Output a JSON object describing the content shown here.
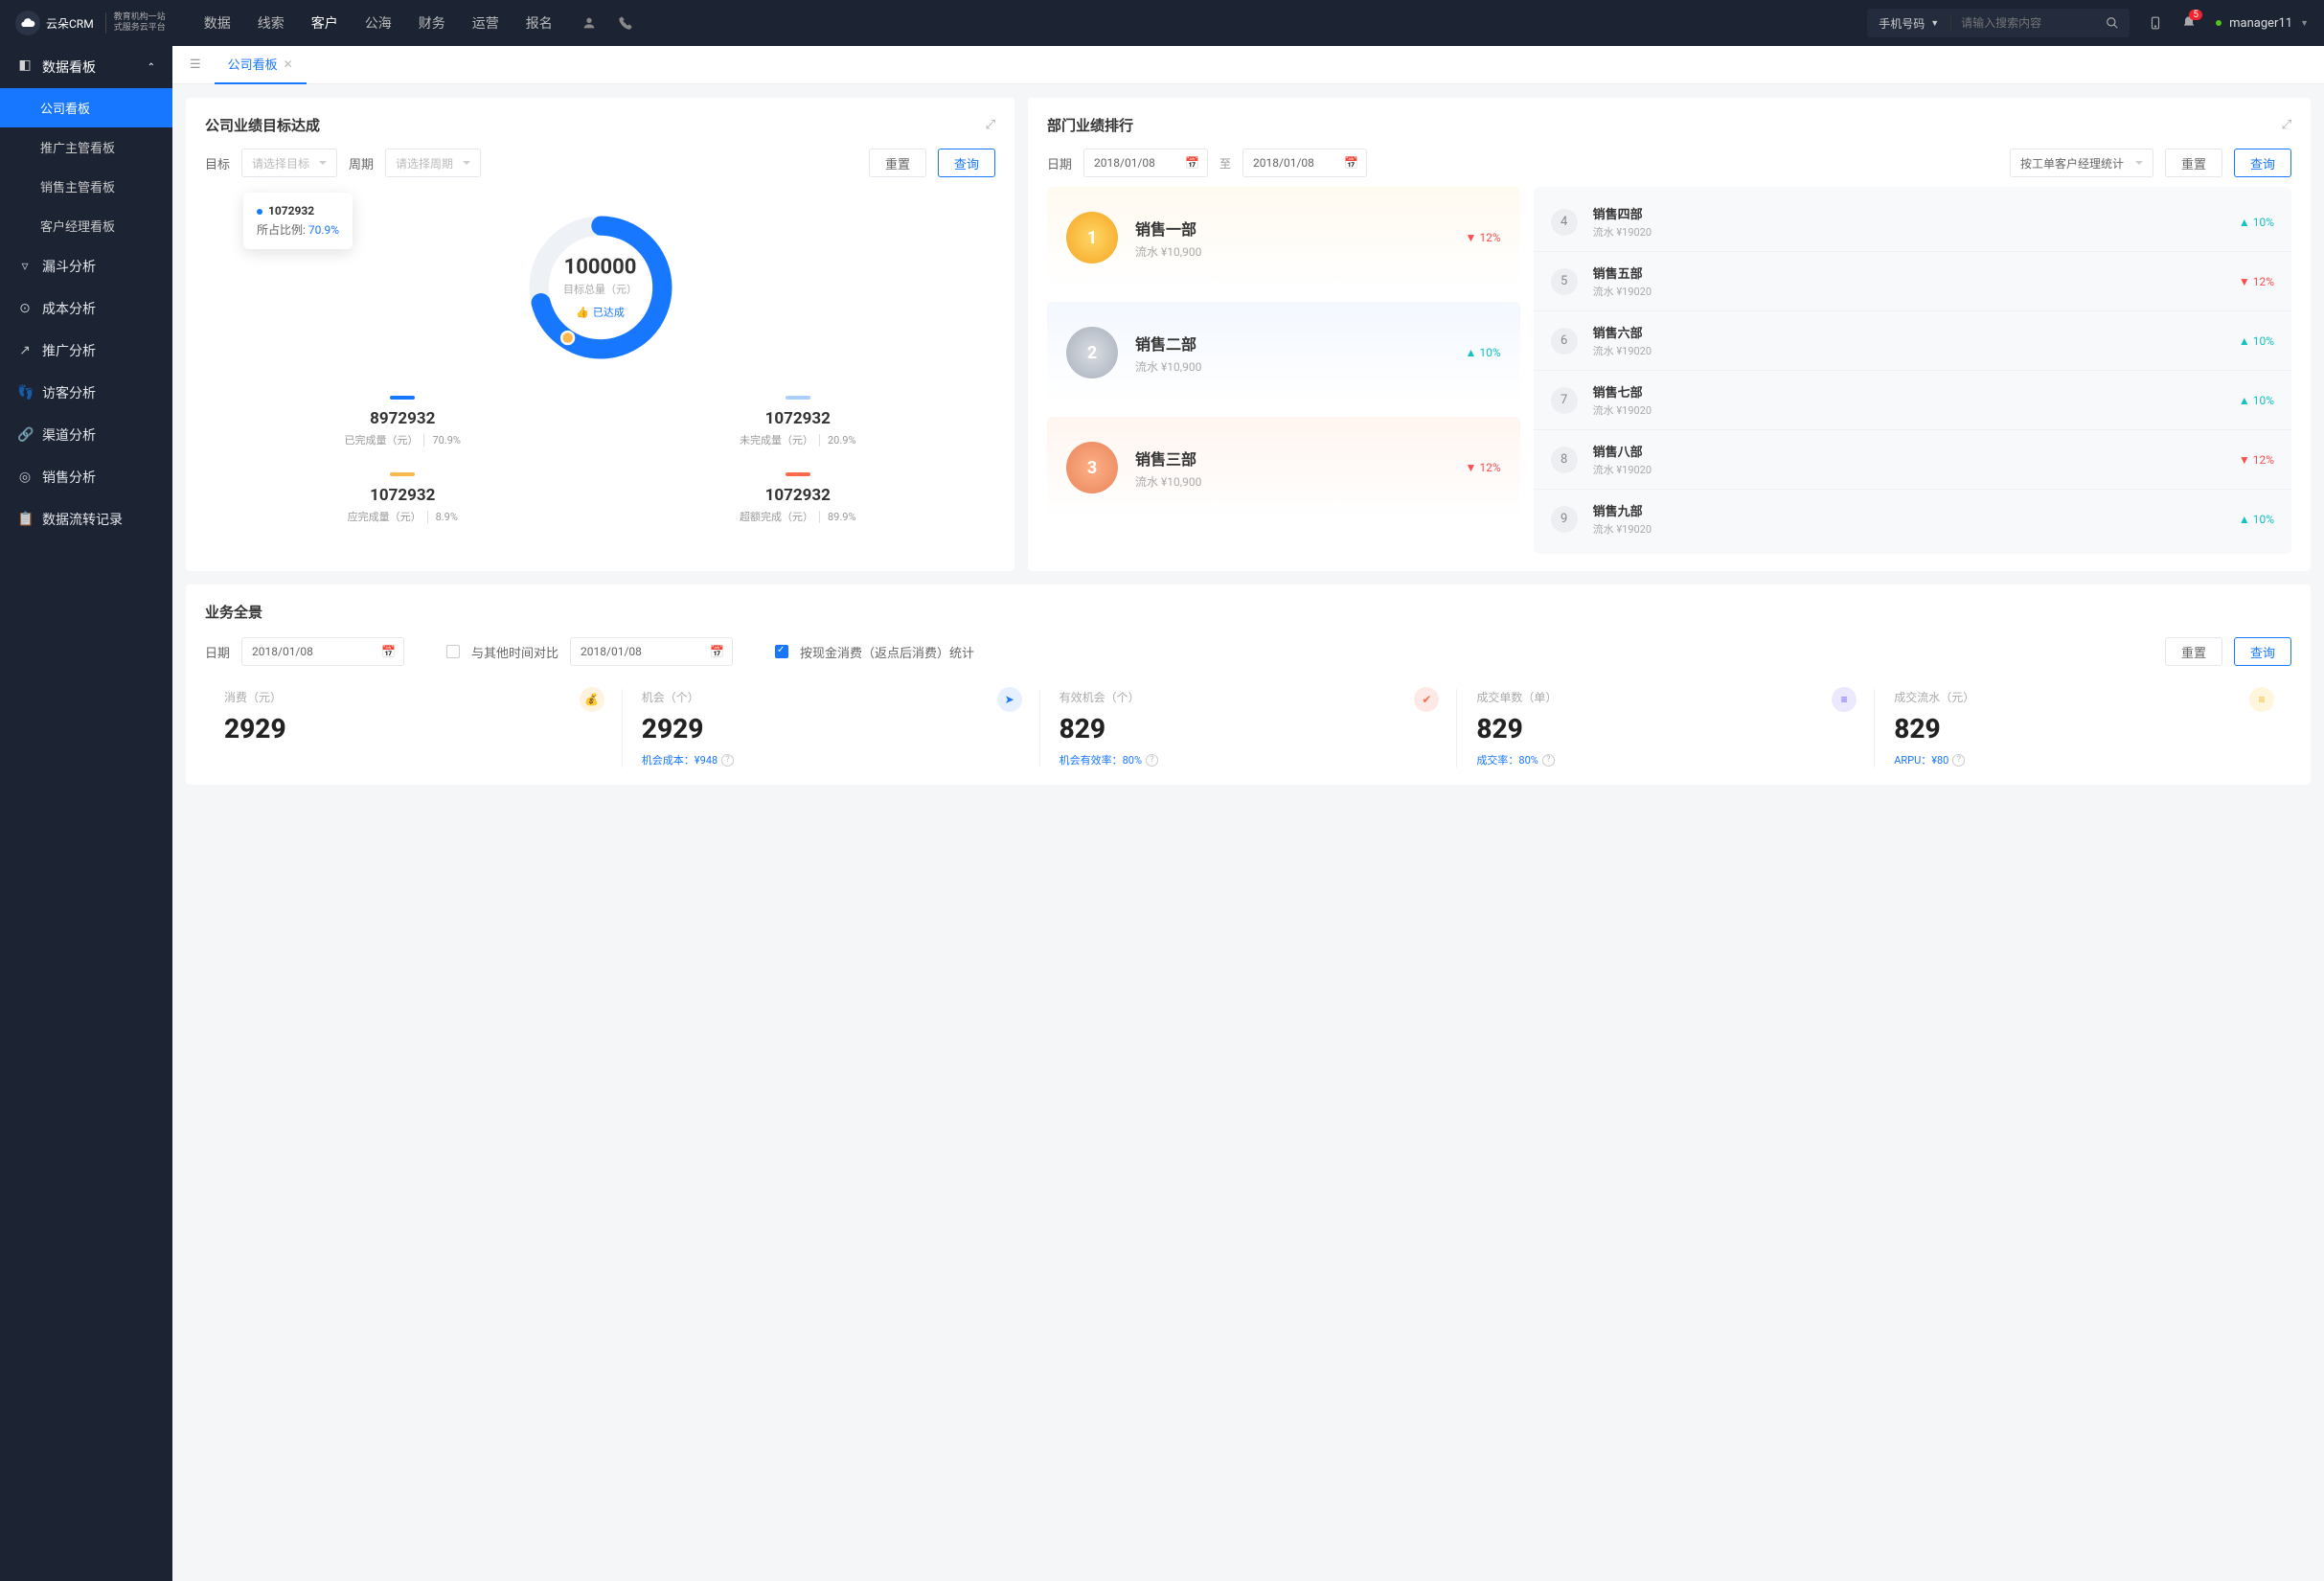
{
  "brand": {
    "name": "云朵CRM",
    "sub1": "教育机构一站",
    "sub2": "式服务云平台"
  },
  "nav": [
    "数据",
    "线索",
    "客户",
    "公海",
    "财务",
    "运营",
    "报名"
  ],
  "nav_active": 2,
  "search": {
    "type": "手机号码",
    "placeholder": "请输入搜索内容"
  },
  "notif_count": "5",
  "user": "manager11",
  "sidebar": {
    "head": "数据看板",
    "subs": [
      "公司看板",
      "推广主管看板",
      "销售主管看板",
      "客户经理看板"
    ],
    "items": [
      "漏斗分析",
      "成本分析",
      "推广分析",
      "访客分析",
      "渠道分析",
      "销售分析",
      "数据流转记录"
    ]
  },
  "tab": {
    "label": "公司看板"
  },
  "goal": {
    "title": "公司业绩目标达成",
    "lbl_target": "目标",
    "ph_target": "请选择目标",
    "lbl_period": "周期",
    "ph_period": "请选择周期",
    "btn_reset": "重置",
    "btn_query": "查询",
    "tooltip_val": "1072932",
    "tooltip_lbl": "所占比例:",
    "tooltip_pct": "70.9%",
    "center_val": "100000",
    "center_lbl": "目标总量（元）",
    "center_badge": "已达成",
    "legs": [
      {
        "color": "#1877ff",
        "val": "8972932",
        "lbl": "已完成量（元）",
        "pct": "70.9%"
      },
      {
        "color": "#a9cfff",
        "val": "1072932",
        "lbl": "未完成量（元）",
        "pct": "20.9%"
      },
      {
        "color": "#ffb84d",
        "val": "1072932",
        "lbl": "应完成量（元）",
        "pct": "8.9%"
      },
      {
        "color": "#ff6a4d",
        "val": "1072932",
        "lbl": "超额完成（元）",
        "pct": "89.9%"
      }
    ]
  },
  "rank": {
    "title": "部门业绩排行",
    "lbl_date": "日期",
    "date1": "2018/01/08",
    "to": "至",
    "date2": "2018/01/08",
    "by": "按工单客户经理统计",
    "btn_reset": "重置",
    "btn_query": "查询",
    "podium": [
      {
        "name": "销售一部",
        "sub": "流水 ¥10,900",
        "delta": "12%",
        "dir": "dn"
      },
      {
        "name": "销售二部",
        "sub": "流水 ¥10,900",
        "delta": "10%",
        "dir": "up"
      },
      {
        "name": "销售三部",
        "sub": "流水 ¥10,900",
        "delta": "12%",
        "dir": "dn"
      }
    ],
    "list": [
      {
        "n": "4",
        "name": "销售四部",
        "sub": "流水 ¥19020",
        "delta": "10%",
        "dir": "up"
      },
      {
        "n": "5",
        "name": "销售五部",
        "sub": "流水 ¥19020",
        "delta": "12%",
        "dir": "dn"
      },
      {
        "n": "6",
        "name": "销售六部",
        "sub": "流水 ¥19020",
        "delta": "10%",
        "dir": "up"
      },
      {
        "n": "7",
        "name": "销售七部",
        "sub": "流水 ¥19020",
        "delta": "10%",
        "dir": "up"
      },
      {
        "n": "8",
        "name": "销售八部",
        "sub": "流水 ¥19020",
        "delta": "12%",
        "dir": "dn"
      },
      {
        "n": "9",
        "name": "销售九部",
        "sub": "流水 ¥19020",
        "delta": "10%",
        "dir": "up"
      }
    ]
  },
  "overview": {
    "title": "业务全景",
    "lbl_date": "日期",
    "date1": "2018/01/08",
    "compare": "与其他时间对比",
    "date2": "2018/01/08",
    "chk_lbl": "按现金消费（返点后消费）统计",
    "btn_reset": "重置",
    "btn_query": "查询",
    "kpis": [
      {
        "lbl": "消费（元）",
        "val": "2929",
        "meta": "",
        "icon": "orange",
        "g": "💰"
      },
      {
        "lbl": "机会（个）",
        "val": "2929",
        "meta": "机会成本：¥948",
        "icon": "blue",
        "g": "➤"
      },
      {
        "lbl": "有效机会（个）",
        "val": "829",
        "meta": "机会有效率：80%",
        "icon": "red",
        "g": "✔"
      },
      {
        "lbl": "成交单数（单）",
        "val": "829",
        "meta": "成交率：80%",
        "icon": "purple",
        "g": "≡"
      },
      {
        "lbl": "成交流水（元）",
        "val": "829",
        "meta": "ARPU：¥80",
        "icon": "yellow",
        "g": "≡"
      }
    ]
  },
  "chart_data": {
    "type": "pie",
    "title": "公司业绩目标达成",
    "total_label": "目标总量（元）",
    "total": 100000,
    "series": [
      {
        "name": "已完成量（元）",
        "value": 8972932,
        "pct": 70.9,
        "color": "#1877ff"
      },
      {
        "name": "未完成量（元）",
        "value": 1072932,
        "pct": 20.9,
        "color": "#a9cfff"
      },
      {
        "name": "应完成量（元）",
        "value": 1072932,
        "pct": 8.9,
        "color": "#ffb84d"
      },
      {
        "name": "超额完成（元）",
        "value": 1072932,
        "pct": 89.9,
        "color": "#ff6a4d"
      }
    ],
    "tooltip": {
      "value": 1072932,
      "ratio_label": "所占比例",
      "ratio": 70.9
    }
  }
}
